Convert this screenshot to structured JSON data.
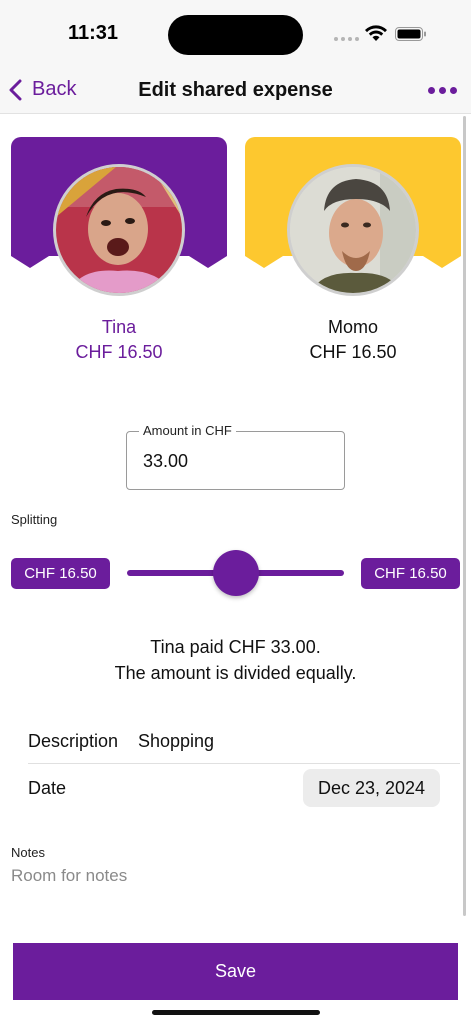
{
  "status_bar": {
    "time": "11:31"
  },
  "nav": {
    "back_label": "Back",
    "title": "Edit shared expense",
    "more_icon": "ellipsis-icon"
  },
  "colors": {
    "accent": "#6b1d9c",
    "tina_banner": "#6b1d9c",
    "momo_banner": "#fdc82f",
    "date_bg": "#ececec"
  },
  "people": [
    {
      "name": "Tina",
      "amount": "CHF 16.50"
    },
    {
      "name": "Momo",
      "amount": "CHF 16.50"
    }
  ],
  "amount": {
    "label": "Amount in CHF",
    "value": "33.00"
  },
  "splitting": {
    "label": "Splitting",
    "left_value": "CHF 16.50",
    "right_value": "CHF 16.50",
    "slider_fraction": 0.5
  },
  "summary": {
    "line1": "Tina paid CHF 33.00.",
    "line2": "The amount is divided equally."
  },
  "details": {
    "description_label": "Description",
    "description_value": "Shopping",
    "date_label": "Date",
    "date_value": "Dec 23, 2024"
  },
  "notes": {
    "label": "Notes",
    "placeholder": "Room for notes"
  },
  "save_label": "Save"
}
